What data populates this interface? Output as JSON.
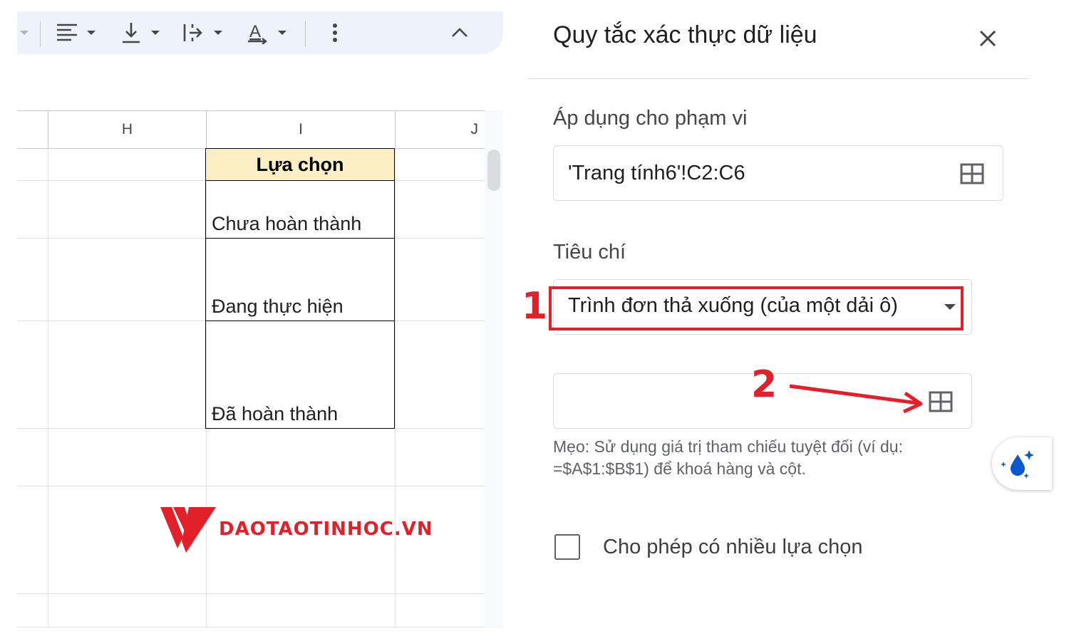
{
  "toolbar": {
    "items": [
      "align-left-icon",
      "vertical-align-bottom-icon",
      "text-direction-icon",
      "text-color-icon",
      "more-vert-icon",
      "collapse-chevron-icon"
    ]
  },
  "sheet": {
    "columns": [
      "H",
      "I",
      "J"
    ],
    "header_cell": "Lựa chọn",
    "header_fill": "#fdefc4",
    "values": [
      "Chưa hoàn thành",
      "Đang thực hiện",
      "Đã hoàn thành"
    ]
  },
  "watermark": {
    "text": "DAOTAOTINHOC.VN",
    "color": "#e2202a"
  },
  "panel": {
    "title": "Quy tắc xác thực dữ liệu",
    "range_label": "Áp dụng cho phạm vi",
    "range_value": "'Trang tính6'!C2:C6",
    "criteria_label": "Tiêu chí",
    "criteria_value": "Trình đơn thả xuống (của một dải ô)",
    "range_input_value": "",
    "hint": "Mẹo: Sử dụng giá trị tham chiếu tuyệt đối (ví dụ: =$A$1:$B$1) để khoá hàng và cột.",
    "multi_select_label": "Cho phép có nhiều lựa chọn",
    "multi_select_checked": false
  },
  "annotations": {
    "step1": "1",
    "step2": "2",
    "color": "#e2202a"
  }
}
